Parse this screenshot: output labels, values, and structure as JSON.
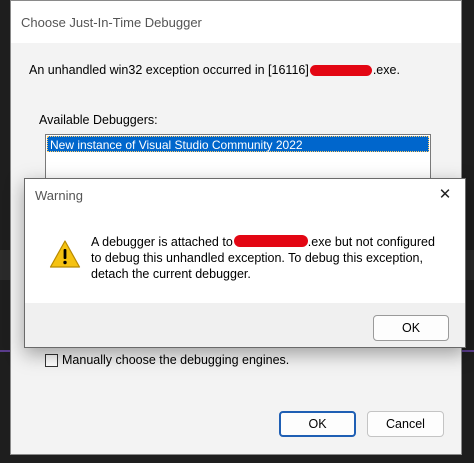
{
  "main_dialog": {
    "title": "Choose Just-In-Time Debugger",
    "exception_prefix": "An unhandled win32 exception occurred in [16116]",
    "exception_suffix": ".exe.",
    "available_label": "Available Debuggers:",
    "debuggers": [
      "New instance of Visual Studio Community 2022"
    ],
    "manual_engines_label": "Manually choose the debugging engines.",
    "manual_engines_checked": false,
    "ok_label": "OK",
    "cancel_label": "Cancel"
  },
  "warning_dialog": {
    "title": "Warning",
    "close_icon": "close-icon",
    "icon": "warning-icon",
    "message_line1_prefix": "A debugger is attached to",
    "message_line1_suffix": ".exe but not configured",
    "message_line2": "to debug this unhandled exception. To debug this exception,",
    "message_line3": "detach the current debugger.",
    "ok_label": "OK"
  },
  "colors": {
    "selection": "#0066cc",
    "redaction": "#e30613",
    "warning_icon": "#f5c211",
    "default_button_border": "#1f5fb4"
  }
}
